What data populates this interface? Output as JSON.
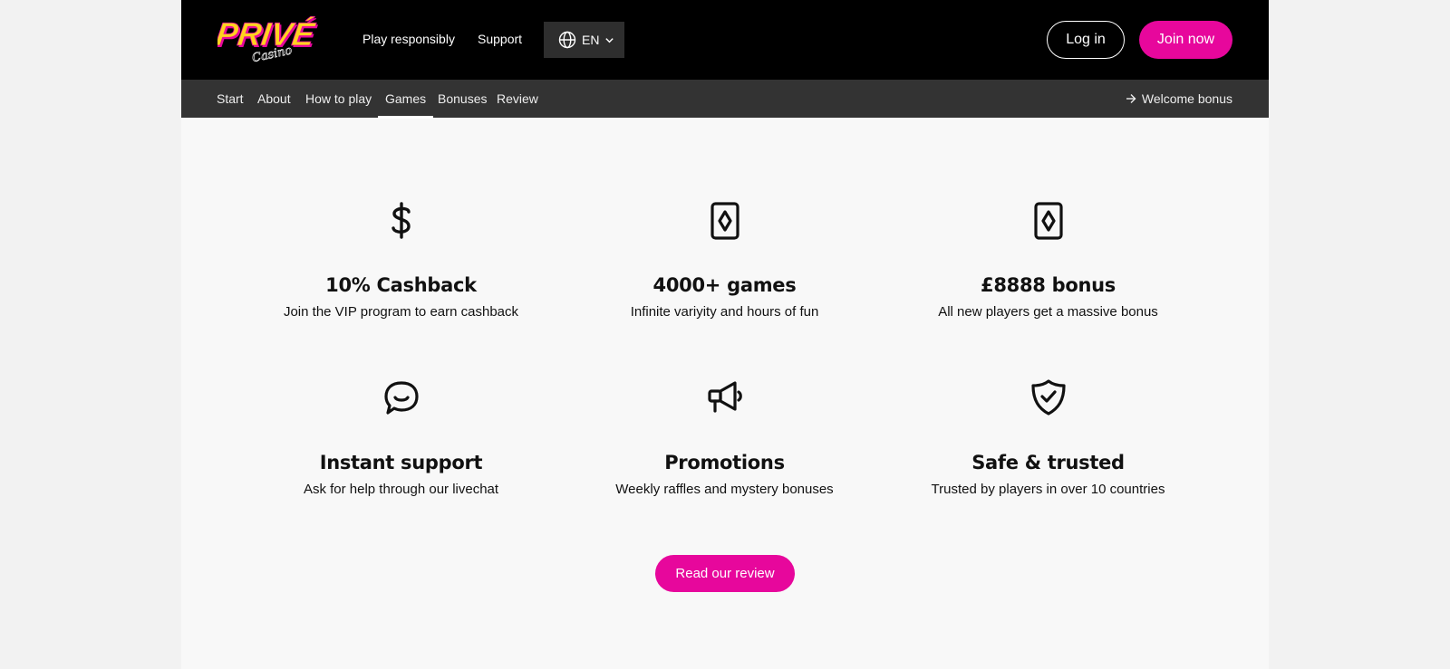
{
  "header": {
    "logo_text": "PRIVÉ",
    "logo_sub": "Casino",
    "links": [
      "Play responsibly",
      "Support"
    ],
    "language": "EN",
    "login_label": "Log in",
    "join_label": "Join now"
  },
  "subnav": {
    "items": [
      "Start",
      "About",
      "How to play",
      "Games",
      "Bonuses",
      "Review"
    ],
    "active": "Games",
    "welcome_label": "Welcome bonus"
  },
  "features": [
    {
      "icon": "dollar-icon",
      "title": "10% Cashback",
      "desc": "Join the VIP program to earn cashback"
    },
    {
      "icon": "card-diamond-icon",
      "title": "4000+ games",
      "desc": "Infinite variyity and hours of fun"
    },
    {
      "icon": "card-diamond-icon",
      "title": "£8888 bonus",
      "desc": "All new players get a massive bonus"
    },
    {
      "icon": "chat-bubble-icon",
      "title": "Instant support",
      "desc": "Ask for help through our livechat"
    },
    {
      "icon": "megaphone-icon",
      "title": "Promotions",
      "desc": "Weekly raffles and mystery bonuses"
    },
    {
      "icon": "shield-check-icon",
      "title": "Safe & trusted",
      "desc": "Trusted by players in over 10 countries"
    }
  ],
  "cta": {
    "review_label": "Read our review"
  },
  "colors": {
    "accent": "#e7079c",
    "header_bg": "#000000",
    "subnav_bg": "#333333",
    "page_bg": "#f8f8f8"
  }
}
